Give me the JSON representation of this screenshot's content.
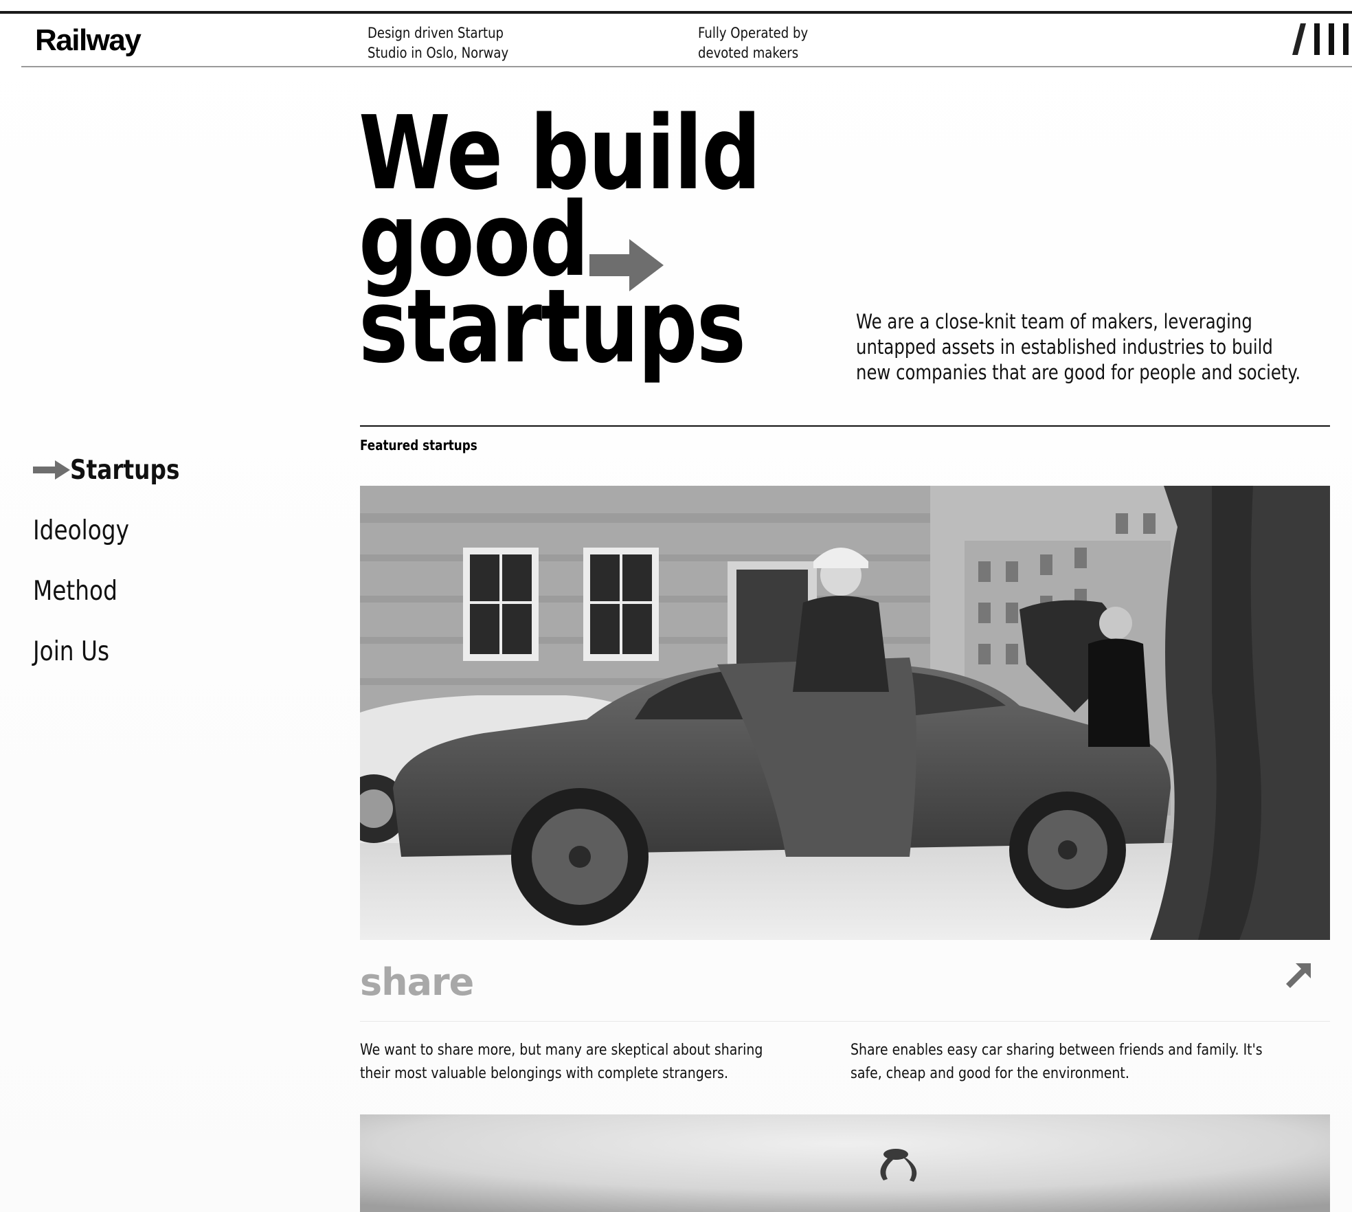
{
  "header": {
    "logo": "Railway",
    "tagline_1": [
      "Design driven Startup",
      "Studio in Oslo, Norway"
    ],
    "tagline_2": [
      "Fully Operated by",
      "devoted makers"
    ],
    "menu_icon": "menu-slashes-icon"
  },
  "hero": {
    "title_lines": [
      "We build",
      "good",
      "startups"
    ],
    "arrow_icon": "right-arrow-icon",
    "intro": "We are a close-knit team of makers, leveraging untapped assets in established industries to build new companies that are good for people and society."
  },
  "nav": {
    "items": [
      {
        "label": "Startups",
        "active": true
      },
      {
        "label": "Ideology",
        "active": false
      },
      {
        "label": "Method",
        "active": false
      },
      {
        "label": "Join Us",
        "active": false
      }
    ]
  },
  "featured": {
    "label": "Featured startups",
    "cards": [
      {
        "logo": "share",
        "link_icon": "diagonal-arrow-icon",
        "problem": "We want to share more, but many are skeptical about sharing their most valuable belongings with complete strangers.",
        "solution": "Share enables easy car sharing between friends and family. It's safe, cheap and good for the environment."
      }
    ]
  },
  "colors": {
    "text": "#111111",
    "accent_gray": "#6e6e6e",
    "logo_gray": "#a8a8a8"
  }
}
